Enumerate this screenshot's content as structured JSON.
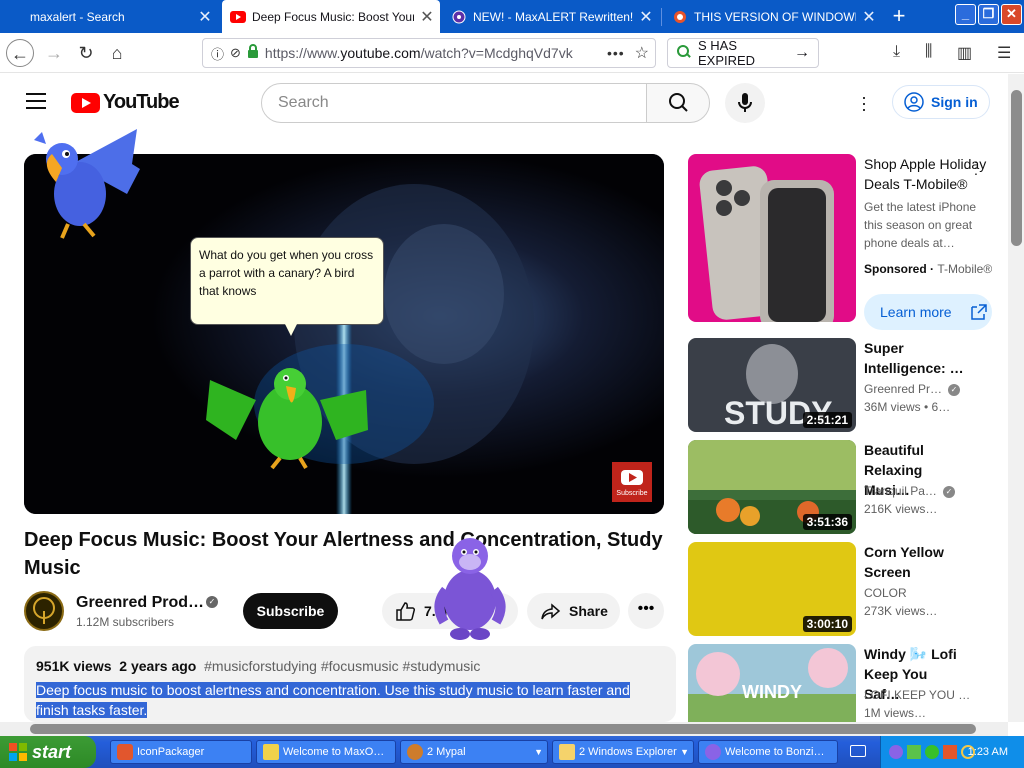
{
  "browser": {
    "tabs": [
      {
        "title": "maxalert - Search",
        "active": false
      },
      {
        "title": "Deep Focus Music: Boost Your Alertn",
        "active": true
      },
      {
        "title": "NEW! - MaxALERT Rewritten!",
        "active": false
      },
      {
        "title": "THIS VERSION OF WINDOWBLINDS",
        "active": false
      }
    ],
    "url_prefix": "https://www.",
    "url_domain": "youtube.com",
    "url_path": "/watch?v=McdghqVd7vk",
    "addon_text": "S HAS EXPIRED"
  },
  "youtube": {
    "logo_text": "YouTube",
    "search_placeholder": "Search",
    "signin_label": "Sign in"
  },
  "video": {
    "title": "Deep Focus Music: Boost Your Alertness and Concentration, Study Music",
    "channel": "Greenred Prod…",
    "subscribers": "1.12M subscribers",
    "subscribe_label": "Subscribe",
    "likes": "7.7K",
    "share_label": "Share",
    "views": "951K views",
    "age": "2 years ago",
    "hashtags": "#musicforstudying #focusmusic #studymusic",
    "description": "Deep focus music to boost alertness and concentration. Use this study music to learn faster and finish tasks faster.",
    "player_badge": "Subscribe"
  },
  "balloon": {
    "text": "What do you get when you cross a parrot with a canary? A bird that knows"
  },
  "ad": {
    "title": "Shop Apple Holiday Deals T-Mobile®",
    "description": "Get the latest iPhone this season on great phone deals at…",
    "sponsored": "Sponsored",
    "advertiser": "T-Mobile®",
    "cta": "Learn more"
  },
  "recommendations": [
    {
      "title": "Super Intelligence: …",
      "channel": "Greenred Pr…",
      "verified": true,
      "views": "36M views • 6…",
      "duration": "2:51:21",
      "thumb_text": "STUDY",
      "thumb_color": "#3a3f48"
    },
    {
      "title": "Beautiful Relaxing Musi…",
      "channel": "Tranquil Pa…",
      "verified": true,
      "views": "216K views…",
      "duration": "3:51:36",
      "thumb_text": "",
      "thumb_color": "#3d6e3a"
    },
    {
      "title": "Corn Yellow Screen",
      "channel": "COLOR",
      "verified": false,
      "views": "273K views…",
      "duration": "3:00:10",
      "thumb_text": "",
      "thumb_color": "#e0c813"
    },
    {
      "title": "Windy 🌬️ Lofi Keep You Saf…",
      "channel": "LOFI KEEP YOU …",
      "verified": false,
      "views": "1M views…",
      "duration": "",
      "thumb_text": "WINDY",
      "thumb_color": "#9ec7d9"
    }
  ],
  "taskbar": {
    "start_label": "start",
    "items": [
      {
        "label": "IconPackager"
      },
      {
        "label": "Welcome to MaxO…"
      },
      {
        "label": "2 Mypal"
      },
      {
        "label": "2 Windows Explorer"
      },
      {
        "label": "Welcome to Bonzi…"
      }
    ],
    "clock": "1:23 AM"
  },
  "colors": {
    "taskbar_blue": "#245edb",
    "firefox_blue": "#0a5ac7",
    "youtube_red": "#ff0000",
    "selection": "#3367d6"
  }
}
